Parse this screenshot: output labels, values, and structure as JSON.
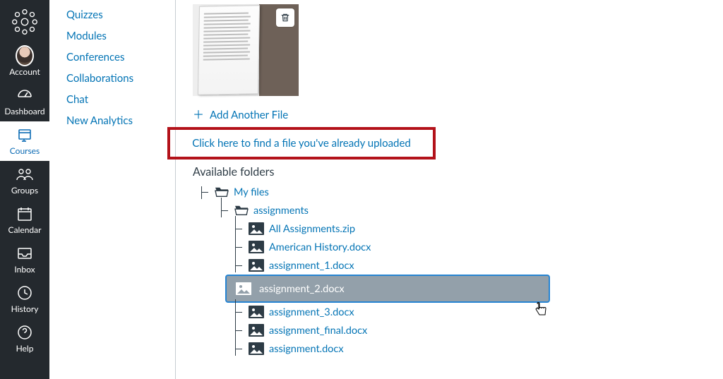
{
  "globalNav": {
    "items": [
      {
        "key": "account",
        "label": "Account"
      },
      {
        "key": "dashboard",
        "label": "Dashboard"
      },
      {
        "key": "courses",
        "label": "Courses"
      },
      {
        "key": "groups",
        "label": "Groups"
      },
      {
        "key": "calendar",
        "label": "Calendar"
      },
      {
        "key": "inbox",
        "label": "Inbox"
      },
      {
        "key": "history",
        "label": "History"
      },
      {
        "key": "help",
        "label": "Help"
      }
    ],
    "activeKey": "courses"
  },
  "courseNav": {
    "items": [
      "Quizzes",
      "Modules",
      "Conferences",
      "Collaborations",
      "Chat",
      "New Analytics"
    ]
  },
  "upload": {
    "addAnother": "Add Another File",
    "findExisting": "Click here to find a file you've already uploaded",
    "availableFolders": "Available folders"
  },
  "tree": {
    "root": {
      "label": "My files"
    },
    "folder": {
      "label": "assignments"
    },
    "files": [
      {
        "name": "All Assignments.zip"
      },
      {
        "name": "American History.docx"
      },
      {
        "name": "assignment_1.docx"
      },
      {
        "name": "assignment_2.docx",
        "selected": true
      },
      {
        "name": "assignment_3.docx"
      },
      {
        "name": "assignment_final.docx"
      },
      {
        "name": "assignment.docx"
      }
    ]
  }
}
